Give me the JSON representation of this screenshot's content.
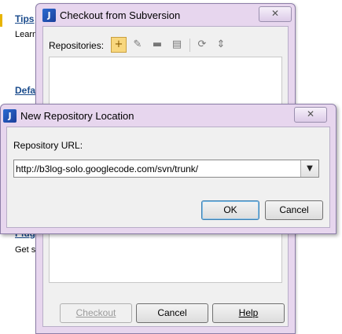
{
  "background": {
    "link1": "Tips",
    "text1": "Learn",
    "link2": "Defa",
    "link3": "Plug",
    "text3": "Get st"
  },
  "checkout_window": {
    "app_icon": "J",
    "title": "Checkout from Subversion",
    "close_icon": "✕",
    "repositories_label": "Repositories:",
    "toolbar": [
      {
        "icon": "add-icon",
        "glyph": "+"
      },
      {
        "icon": "edit-icon",
        "glyph": "✎"
      },
      {
        "icon": "remove-icon",
        "glyph": "▬"
      },
      {
        "icon": "browse-icon",
        "glyph": "▤"
      },
      {
        "icon": "refresh-icon",
        "glyph": "⟳"
      },
      {
        "icon": "collapse-icon",
        "glyph": "⇕"
      }
    ],
    "buttons": {
      "checkout": "Checkout",
      "cancel": "Cancel",
      "help": "Help"
    }
  },
  "repository_dialog": {
    "app_icon": "J",
    "title": "New Repository Location",
    "close_icon": "✕",
    "url_label": "Repository URL:",
    "url_value": "http://b3log-solo.googlecode.com/svn/trunk/",
    "dropdown_icon": "▼",
    "buttons": {
      "ok": "OK",
      "cancel": "Cancel"
    }
  }
}
